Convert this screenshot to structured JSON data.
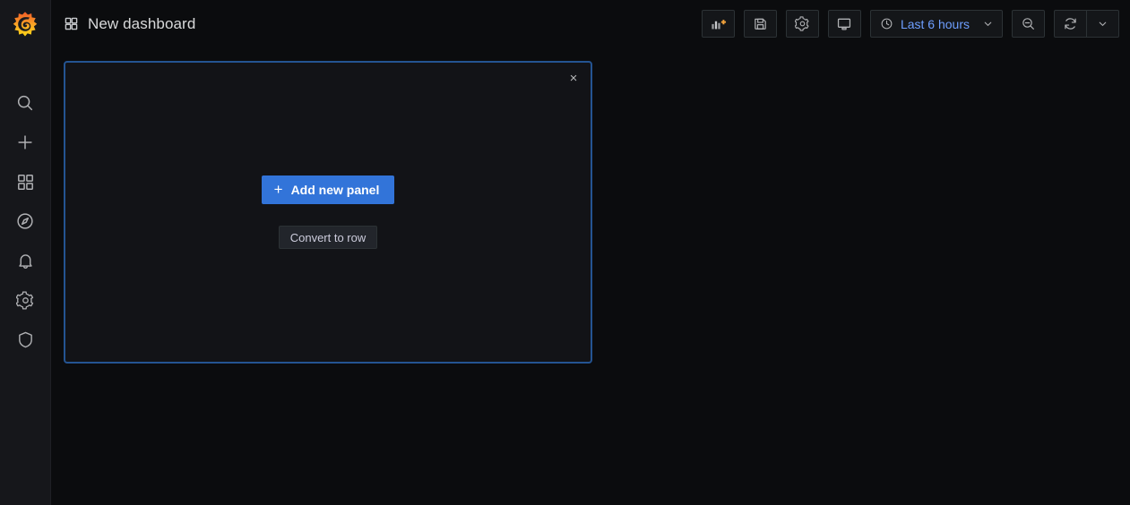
{
  "app": {
    "logo": "grafana-logo",
    "brand_colors": {
      "orange": "#ef5f28",
      "yellow": "#f9c51c",
      "blue_accent": "#3274d9",
      "panel_border": "#245492",
      "sidebar_bg": "#16171b",
      "page_bg": "#0b0c0e",
      "link_blue": "#6e9fff"
    }
  },
  "sidebar": {
    "items": [
      {
        "name": "search-icon",
        "label": "Search"
      },
      {
        "name": "plus-icon",
        "label": "Create"
      },
      {
        "name": "dashboards-icon",
        "label": "Dashboards"
      },
      {
        "name": "compass-icon",
        "label": "Explore"
      },
      {
        "name": "bell-icon",
        "label": "Alerting"
      },
      {
        "name": "gear-icon",
        "label": "Configuration"
      },
      {
        "name": "shield-icon",
        "label": "Server Admin"
      }
    ]
  },
  "header": {
    "grid_icon": "dashboard-grid-icon",
    "title": "New dashboard",
    "toolbar": [
      {
        "name": "add-panel-icon",
        "label": "Add panel"
      },
      {
        "name": "save-icon",
        "label": "Save dashboard"
      },
      {
        "name": "settings-icon",
        "label": "Dashboard settings"
      },
      {
        "name": "kiosk-icon",
        "label": "Cycle view mode"
      }
    ],
    "time_picker": {
      "icon": "clock-icon",
      "value": "Last 6 hours",
      "caret": "chevron-down-icon"
    },
    "zoom_out": {
      "name": "zoom-out-icon",
      "label": "Zoom out time range"
    },
    "refresh": {
      "name": "refresh-icon",
      "label": "Refresh dashboard"
    },
    "refresh_interval": {
      "name": "chevron-down-icon",
      "label": "Set auto refresh interval"
    }
  },
  "panel": {
    "close_label": "×",
    "add_panel_button": {
      "icon": "plus-icon",
      "label": "Add new panel"
    },
    "convert_to_row_button": {
      "label": "Convert to row"
    }
  }
}
